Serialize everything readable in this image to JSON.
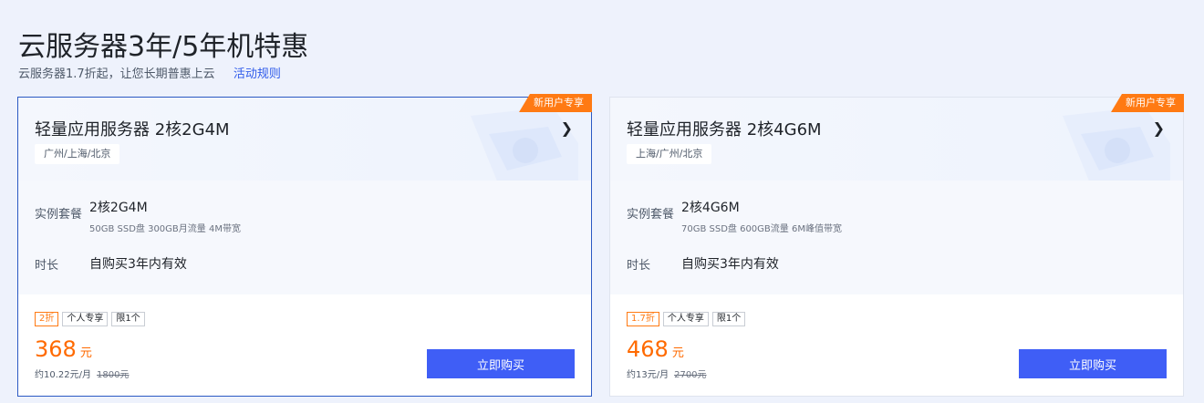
{
  "header": {
    "title": "云服务器3年/5年机特惠",
    "subtitle": "云服务器1.7折起，让您长期普惠上云",
    "rules_link": "活动规则"
  },
  "cards": [
    {
      "ribbon": "新用户专享",
      "title": "轻量应用服务器 2核2G4M",
      "region": "广州/上海/北京",
      "spec_label": "实例套餐",
      "spec_main": "2核2G4M",
      "spec_sub": "50GB SSD盘 300GB月流量 4M带宽",
      "duration_label": "时长",
      "duration": "自购买3年内有效",
      "tags": [
        "2折",
        "个人专享",
        "限1个"
      ],
      "price": "368",
      "price_unit": "元",
      "monthly": "约10.22元/月",
      "original": "1800元",
      "buy_label": "立即购买"
    },
    {
      "ribbon": "新用户专享",
      "title": "轻量应用服务器 2核4G6M",
      "region": "上海/广州/北京",
      "spec_label": "实例套餐",
      "spec_main": "2核4G6M",
      "spec_sub": "70GB SSD盘 600GB流量 6M峰值带宽",
      "duration_label": "时长",
      "duration": "自购买3年内有效",
      "tags": [
        "1.7折",
        "个人专享",
        "限1个"
      ],
      "price": "468",
      "price_unit": "元",
      "monthly": "约13元/月",
      "original": "2700元",
      "buy_label": "立即购买"
    }
  ],
  "icons": {
    "chevron": "chevron-right-icon"
  },
  "colors": {
    "accent": "#3f5ef6",
    "price": "#ff6a00",
    "ribbon": "#ff7a13",
    "active_border": "#2b59c3"
  }
}
